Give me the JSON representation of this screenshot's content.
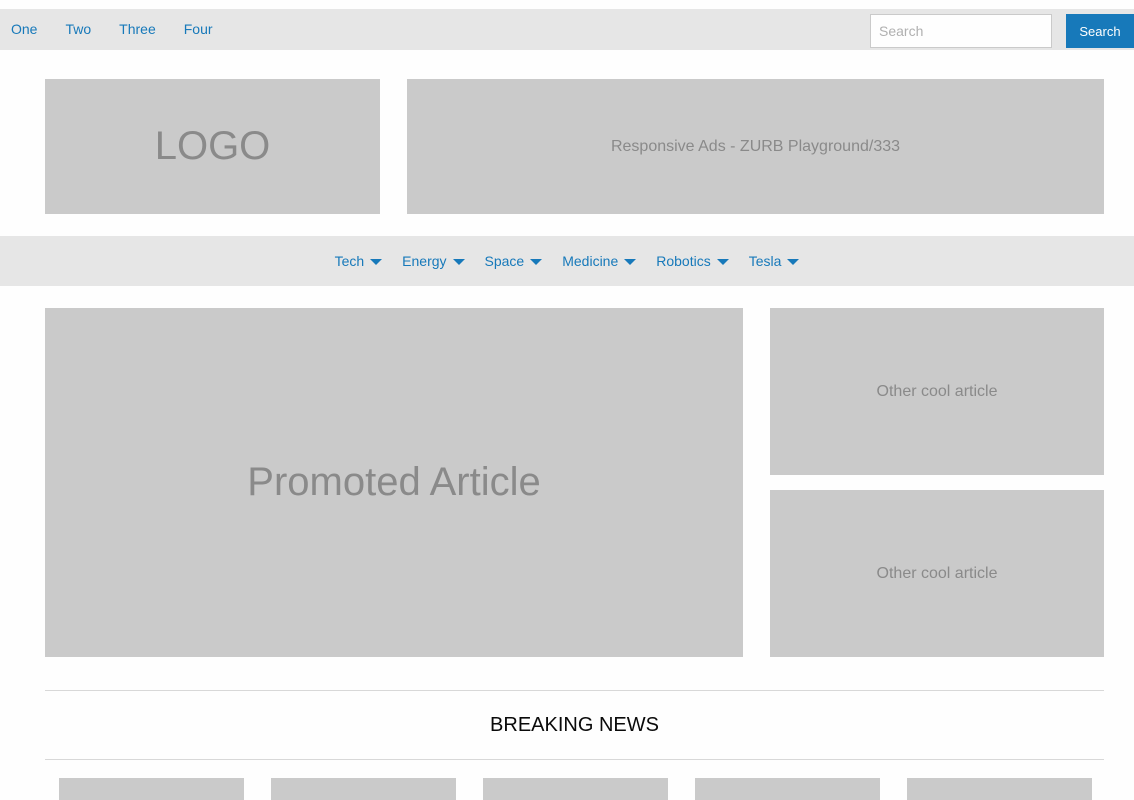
{
  "top_nav": {
    "items": [
      "One",
      "Two",
      "Three",
      "Four"
    ],
    "search_placeholder": "Search",
    "search_button": "Search"
  },
  "header": {
    "logo": "LOGO",
    "ad": "Responsive Ads - ZURB Playground/333"
  },
  "categories": [
    "Tech",
    "Energy",
    "Space",
    "Medicine",
    "Robotics",
    "Tesla"
  ],
  "main": {
    "promoted": "Promoted Article",
    "side_articles": [
      "Other cool article",
      "Other cool article"
    ]
  },
  "breaking_news": {
    "title": "BREAKING NEWS",
    "thumb_count": 5
  },
  "colors": {
    "accent": "#1779ba",
    "placeholder": "#cacaca",
    "bar": "#e6e6e6"
  }
}
